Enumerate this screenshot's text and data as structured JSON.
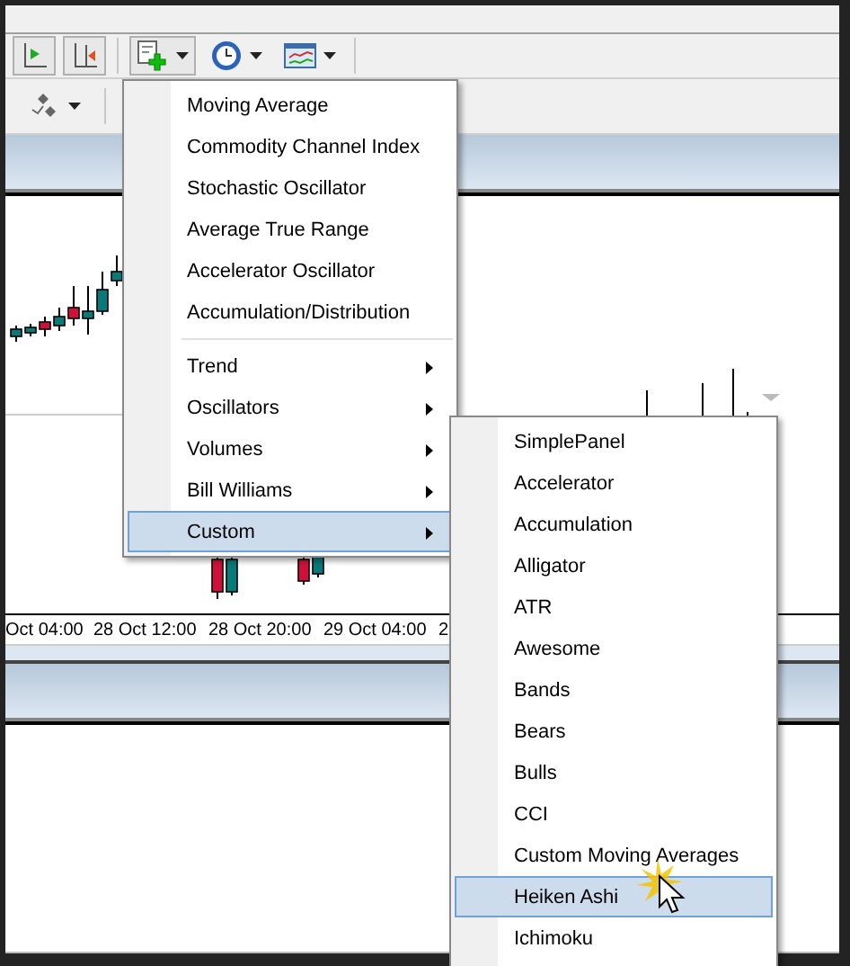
{
  "toolbar": [
    {
      "kind": "autoscroll",
      "selected": true
    },
    {
      "kind": "shift",
      "selected": true
    },
    {
      "kind": "indicators",
      "selected": true
    },
    {
      "kind": "periods",
      "selected": false
    },
    {
      "kind": "templates",
      "selected": false
    }
  ],
  "toolbar_2": [
    {
      "kind": "objects",
      "selected": false
    }
  ],
  "time_axis": [
    "Oct 04:00",
    "28 Oct 12:00",
    "28 Oct 20:00",
    "29 Oct 04:00",
    "2"
  ],
  "indicators_menu": [
    {
      "kind": "item",
      "label": "Moving Average",
      "submenu": false,
      "selected": false
    },
    {
      "kind": "item",
      "label": "Commodity Channel Index",
      "submenu": false,
      "selected": false
    },
    {
      "kind": "item",
      "label": "Stochastic Oscillator",
      "submenu": false,
      "selected": false
    },
    {
      "kind": "item",
      "label": "Average True Range",
      "submenu": false,
      "selected": false
    },
    {
      "kind": "item",
      "label": "Accelerator Oscillator",
      "submenu": false,
      "selected": false
    },
    {
      "kind": "item",
      "label": "Accumulation/Distribution",
      "submenu": false,
      "selected": false
    },
    {
      "kind": "separator"
    },
    {
      "kind": "item",
      "label": "Trend",
      "submenu": true,
      "selected": false
    },
    {
      "kind": "item",
      "label": "Oscillators",
      "submenu": true,
      "selected": false
    },
    {
      "kind": "item",
      "label": "Volumes",
      "submenu": true,
      "selected": false
    },
    {
      "kind": "item",
      "label": "Bill Williams",
      "submenu": true,
      "selected": false
    },
    {
      "kind": "item",
      "label": "Custom",
      "submenu": true,
      "selected": true
    }
  ],
  "custom_submenu": [
    {
      "label": "SimplePanel",
      "selected": false
    },
    {
      "label": "Accelerator",
      "selected": false
    },
    {
      "label": "Accumulation",
      "selected": false
    },
    {
      "label": "Alligator",
      "selected": false
    },
    {
      "label": "ATR",
      "selected": false
    },
    {
      "label": "Awesome",
      "selected": false
    },
    {
      "label": "Bands",
      "selected": false
    },
    {
      "label": "Bears",
      "selected": false
    },
    {
      "label": "Bulls",
      "selected": false
    },
    {
      "label": "CCI",
      "selected": false
    },
    {
      "label": "Custom Moving Averages",
      "selected": false
    },
    {
      "label": "Heiken Ashi",
      "selected": true
    },
    {
      "label": "Ichimoku",
      "selected": false
    }
  ]
}
